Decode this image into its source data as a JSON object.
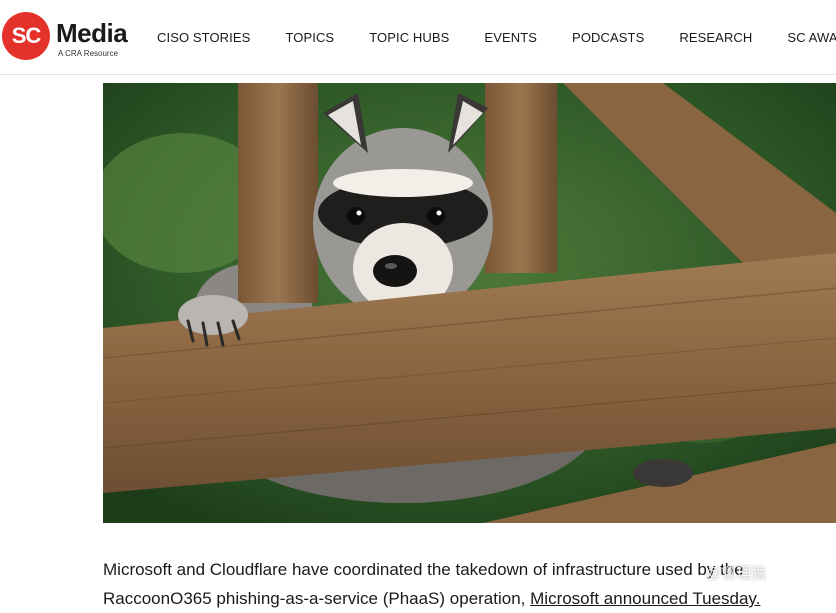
{
  "header": {
    "logo": {
      "badge": "SC",
      "word": "Media",
      "tagline": "A CRA Resource",
      "brand_color": "#e4322b"
    },
    "nav": [
      {
        "label": "CISO STORIES"
      },
      {
        "label": "TOPICS"
      },
      {
        "label": "TOPIC HUBS"
      },
      {
        "label": "EVENTS"
      },
      {
        "label": "PODCASTS"
      },
      {
        "label": "RESEARCH"
      },
      {
        "label": "SC AWARDS"
      }
    ]
  },
  "article": {
    "hero_image": "raccoon peeking through wooden fence",
    "body_start": "Microsoft and Cloudflare have coordinated the takedown of infrastructure used by the RaccoonO365 phishing-as-a-service (PhaaS) operation, ",
    "body_link": "Microsoft announced Tuesday."
  },
  "watermark": "@管理猿"
}
